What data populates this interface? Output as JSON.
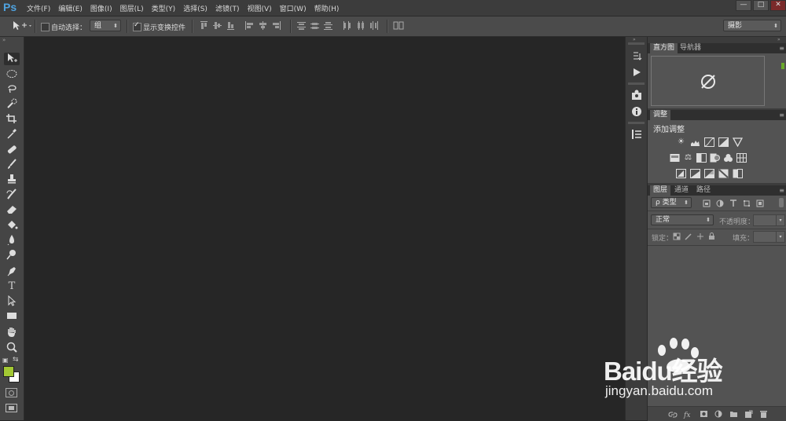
{
  "app": {
    "logo": "Ps"
  },
  "menu": [
    "文件(F)",
    "编辑(E)",
    "图像(I)",
    "图层(L)",
    "类型(Y)",
    "选择(S)",
    "滤镜(T)",
    "视图(V)",
    "窗口(W)",
    "帮助(H)"
  ],
  "window_controls": [
    "—",
    "□",
    "✕"
  ],
  "options_bar": {
    "auto_select_label": "自动选择：",
    "auto_select_checked": false,
    "group_value": "组",
    "show_transform_label": "显示变换控件",
    "show_transform_checked": true,
    "workspace_value": "摄影"
  },
  "tools": [
    "move",
    "ellipse-marquee",
    "lasso",
    "quick-selection",
    "crop",
    "eyedropper",
    "spot-healing",
    "brush",
    "clone-stamp",
    "history-brush",
    "eraser",
    "paint-bucket",
    "blur",
    "dodge",
    "pen",
    "type",
    "path-selection",
    "rectangle",
    "hand",
    "zoom"
  ],
  "colors": {
    "foreground": "#a3c934",
    "background": "#ffffff",
    "accent": "#4fa3e0"
  },
  "panels": {
    "histogram": {
      "tabs": [
        "直方图",
        "导航器"
      ]
    },
    "adjustments": {
      "tab": "调整",
      "title": "添加调整"
    },
    "layers": {
      "tabs": [
        "图层",
        "通道",
        "路径"
      ],
      "filter_value": "ρ 类型",
      "blend_mode": "正常",
      "opacity_label": "不透明度：",
      "lock_label": "锁定：",
      "fill_label": "填充："
    }
  },
  "watermark": {
    "brand": "Baidu经验",
    "url": "jingyan.baidu.com"
  }
}
